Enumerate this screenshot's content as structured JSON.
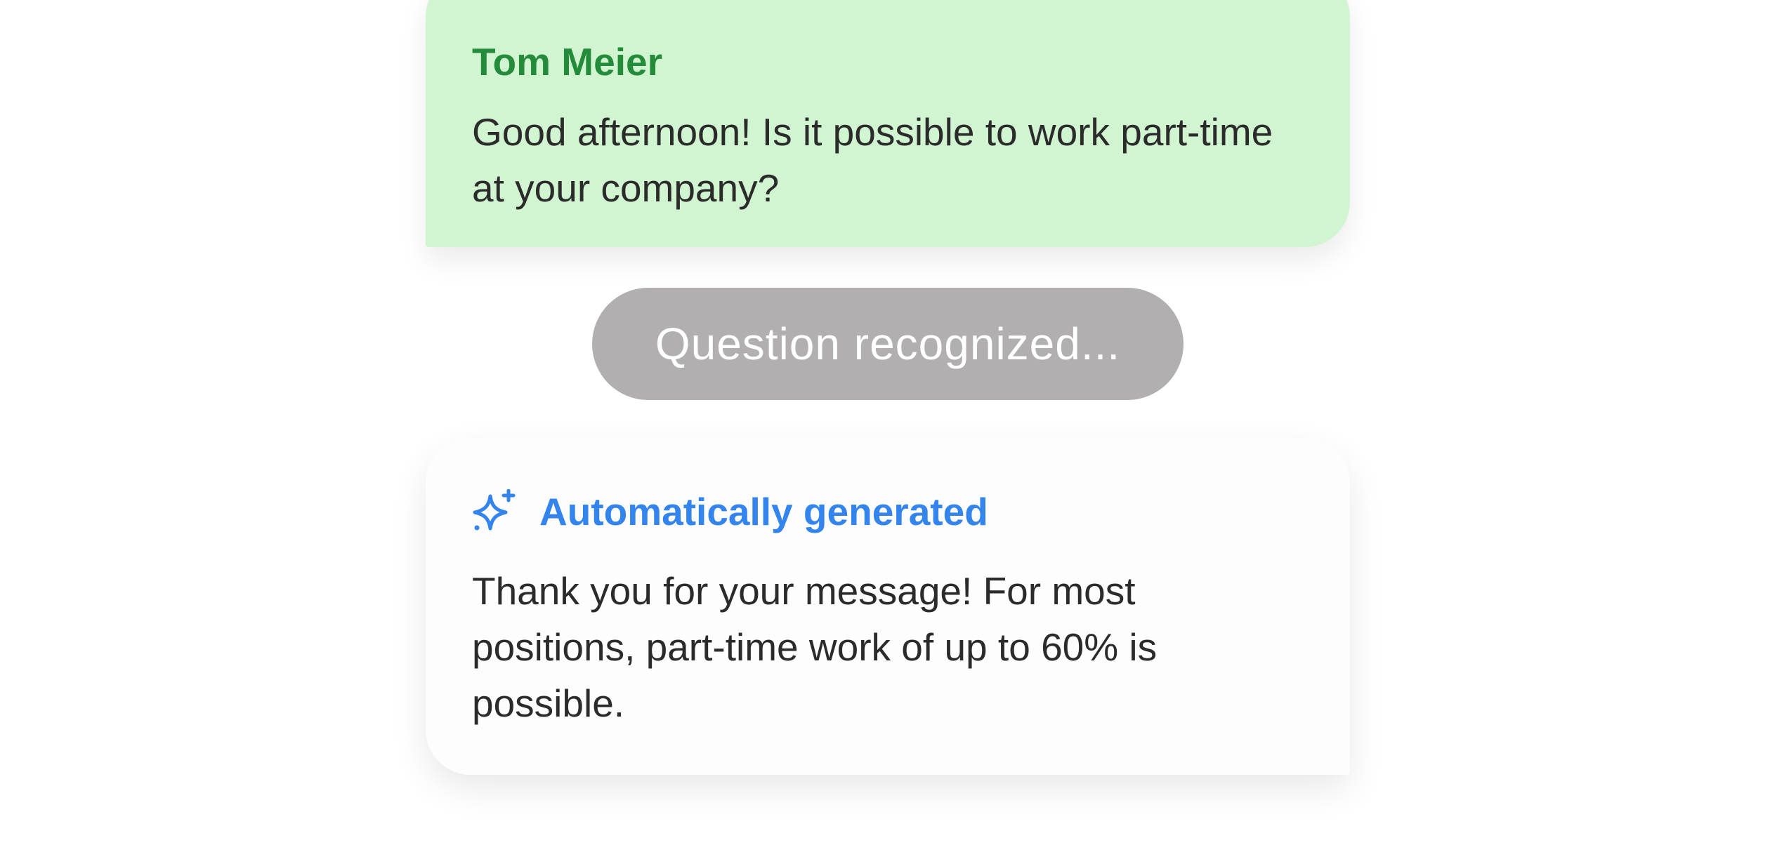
{
  "incoming_message": {
    "sender": "Tom Meier",
    "text": "Good afternoon! Is it possible to work part-time at your company?"
  },
  "status": {
    "text": "Question recognized..."
  },
  "auto_reply": {
    "label": "Automatically generated",
    "icon": "sparkle-icon",
    "text": "Thank you for your message!  For most positions, part-time work of up to 60% is possible."
  },
  "colors": {
    "incoming_bubble": "#d0f5d0",
    "sender_name": "#238b3a",
    "status_pill": "#b1afb0",
    "auto_label": "#3384ec",
    "body_text": "#2b2b2b"
  }
}
